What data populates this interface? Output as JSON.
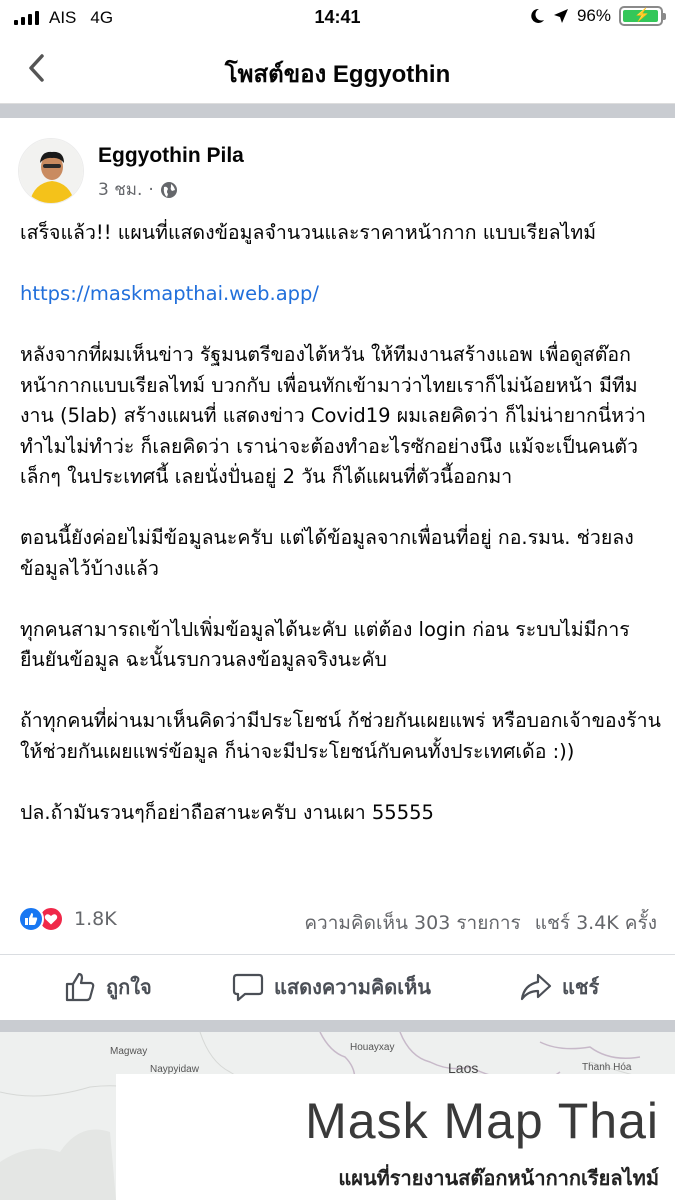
{
  "status_bar": {
    "carrier": "AIS",
    "network": "4G",
    "time": "14:41",
    "battery": "96%",
    "battery_level": 0.96,
    "battery_color": "#34c759"
  },
  "nav": {
    "title": "โพสต์ของ Eggyothin",
    "back_icon": "chevron-left-icon"
  },
  "post": {
    "author": "Eggyothin Pila",
    "time": "3 ชม.",
    "separator": "·",
    "privacy_icon": "globe-icon",
    "paragraphs": [
      "เสร็จแล้ว!! แผนที่แสดงข้อมูลจำนวนและราคาหน้ากาก แบบเรียลไทม์",
      "https://maskmapthai.web.app/",
      "หลังจากที่ผมเห็นข่าว รัฐมนตรีของไต้หวัน ให้ทีมงานสร้างแอพ เพื่อดูสต๊อกหน้ากากแบบเรียลไทม์ บวกกับ เพื่อนทักเข้ามาว่าไทยเราก็ไม่น้อยหน้า มีทีมงาน (5lab) สร้างแผนที่ แสดงข่าว Covid19 ผมเลยคิดว่า ก็ไม่น่ายากนี่หว่า ทำไมไม่ทำว่ะ ก็เลยคิดว่า เราน่าจะต้องทำอะไรซักอย่างนึง แม้จะเป็นคนตัวเล็กๆ ในประเทศนี้ เลยนั่งปั่นอยู่ 2 วัน ก็ได้แผนที่ตัวนี้ออกมา",
      "ตอนนี้ยังค่อยไม่มีข้อมูลนะครับ แต่ได้ข้อมูลจากเพื่อนที่อยู่  กอ.รมน. ช่วยลงข้อมูลไว้บ้างแล้ว",
      "ทุกคนสามารถเข้าไปเพิ่มข้อมูลได้นะคับ แต่ต้อง login ก่อน ระบบไม่มีการยืนยันข้อมูล ฉะนั้นรบกวนลงข้อมูลจริงนะคับ",
      "ถ้าทุกคนที่ผ่านมาเห็นคิดว่ามีประโยชน์ ก้ช่วยกันเผยแพร่ หรือบอกเจ้าของร้านให้ช่วยกันเผยแพร่ข้อมูล ก็น่าจะมีประโยชน์กับคนทั้งประเทศเด้อ :))",
      "ปล.ถ้ามันรวนๆก็อย่าถือสานะครับ งานเผา  55555"
    ],
    "link_color": "#216fdb"
  },
  "engagement": {
    "reaction_count": "1.8K",
    "comments": "ความคิดเห็น 303 รายการ",
    "shares": "แชร์ 3.4K ครั้ง",
    "like_color": "#1877f2",
    "love_color": "#f02849"
  },
  "actions": {
    "like": "ถูกใจ",
    "comment": "แสดงความคิดเห็น",
    "share": "แชร์"
  },
  "link_preview": {
    "map_labels": {
      "magway": "Magway",
      "naypyidaw": "Naypyidaw",
      "houayxay": "Houayxay",
      "laos": "Laos",
      "thanh_hoa": "Thanh Hóa"
    },
    "title": "Mask Map Thai",
    "subtitle": "แผนที่รายงานสต๊อกหน้ากากเรียลไทม์"
  }
}
